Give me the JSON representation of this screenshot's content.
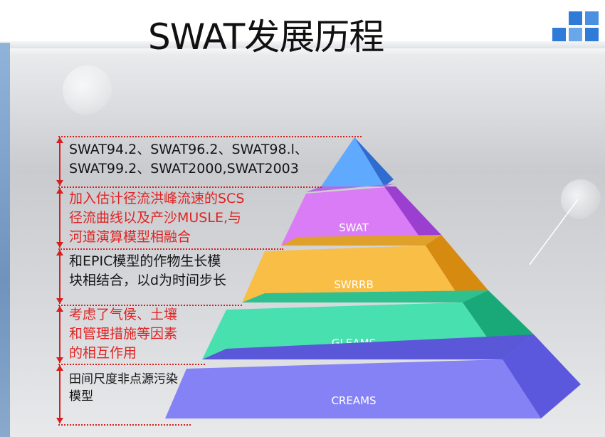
{
  "title": "SWAT发展历程",
  "pyramid": {
    "tiers": [
      {
        "label": "",
        "description_lines": [
          "SWAT94.2、SWAT96.2、SWAT98.l、",
          "SWAT99.2、SWAT2000,SWAT2003"
        ],
        "description_color": "#141414",
        "face_color": "#4c9bff"
      },
      {
        "label": "SWAT",
        "description_lines": [
          "加入估计径流洪峰流速的SCS",
          "径流曲线以及产沙MUSLE,与",
          "河道演算模型相融合"
        ],
        "description_color": "#e02424",
        "face_color": "#d16ef2"
      },
      {
        "label": "SWRRB",
        "description_lines": [
          "和EPIC模型的作物生长模",
          "块相结合，以d为时间步长"
        ],
        "description_color": "#141414",
        "face_color": "#f7b733"
      },
      {
        "label": "GLEAMS",
        "description_lines": [
          "考虑了气侯、土壤",
          "和管理措施等因素",
          "的相互作用"
        ],
        "description_color": "#e02424",
        "face_color": "#3ed9a6"
      },
      {
        "label": "CREAMS",
        "description_lines": [
          "田间尺度非点源污染",
          "模型"
        ],
        "description_color": "#141414",
        "face_color": "#7b78f0"
      }
    ]
  },
  "icons": {
    "logo": "blue-squares-logo",
    "timeline_arrows": "red-double-arrow"
  }
}
